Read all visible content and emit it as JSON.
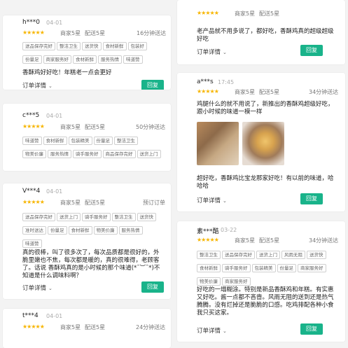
{
  "colors": {
    "accent": "#19b38a",
    "star": "#f7b500"
  },
  "icons": {
    "star": "star-icon",
    "chevron": "chevron-down-icon"
  },
  "ratings": {
    "stars": "★★★★★",
    "merchant": "商家5星",
    "delivery": "配送5星"
  },
  "actions": {
    "order_details": "订单详情",
    "reply": "回复"
  },
  "left": [
    {
      "user": "h***0",
      "time": "04-01",
      "delivery_time": "16分钟送达",
      "tags": [
        "送品保存完好",
        "整洁卫生",
        "送货快",
        "食材新鲜",
        "包装好",
        "份量足",
        "商家服务好",
        "食材新鲜",
        "服务热情",
        "味道赞"
      ],
      "review": "香酥鸡好好吃！年糕老一点会更好"
    },
    {
      "user": "c***5",
      "time": "04-01",
      "delivery_time": "50分钟送达",
      "tags": [
        "味道赞",
        "食材新鲜",
        "包装精美",
        "份量足",
        "整洁卫生",
        "物美价廉",
        "服务热情",
        "骑手服务好",
        "商品保存完好",
        "送货上门"
      ],
      "review": ""
    },
    {
      "user": "V***4",
      "time": "04-01",
      "delivery_time": "预订订单",
      "tags": [
        "送品保存完好",
        "送货上门",
        "骑手服务好",
        "整洁卫生",
        "送货快",
        "准时送达",
        "份量足",
        "食材新鲜",
        "物美价廉",
        "服务热情",
        "味道赞"
      ],
      "review": "真的很棒，叫了很多次了，每次品质都是很好的，外脆里嫩也不焦，每次都是暖的，真的很难得，老顾客了。话说 香酥鸡真的是小时候的那个味道(*¯︶¯*)不知道是什么调味料啊？"
    },
    {
      "user": "t***4",
      "time": "04-01",
      "delivery_time": "24分钟送达"
    }
  ],
  "right": [
    {
      "review": "老产品就不用多说了，都好吃，香酥鸡真的超级超级好吃"
    },
    {
      "user": "a***s",
      "time": "17:45",
      "delivery_time": "34分钟送达",
      "review": "鸡腿什么的就不用说了，新推出的香酥鸡超级好吃，跟小时候的味道一模一样",
      "review2": "超好吃，香酥鸡比宝龙那家好吃！有以前的味道，哈哈哈"
    },
    {
      "user": "素***酷",
      "time": "03-22",
      "delivery_time": "34分钟送达",
      "tags": [
        "整洁卫生",
        "送品保存完好",
        "送货上门",
        "风雨无阻",
        "送货快",
        "食材新鲜",
        "骑手服务好",
        "包装精美",
        "份量足",
        "商家服务好",
        "物美价廉",
        "商家服务好"
      ],
      "review": "好吃的一塌糊涂。特别是新品香酥鸡和年糕。有实惠又好吃。酱一点都不吝啬。风雨无阻的送到还是热气腾腾。没有烂掉还是脆脆的口感。吃鸡排配各种小食我只买这家。"
    }
  ]
}
